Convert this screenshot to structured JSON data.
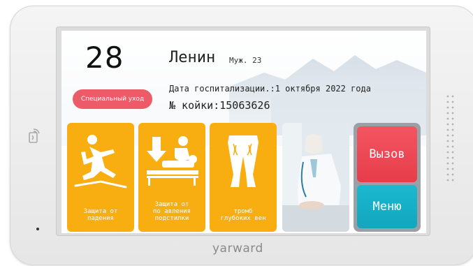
{
  "device": {
    "brand": "yarward",
    "colors": {
      "shell": "#ececec",
      "tile": "#f8ad10",
      "call": "#e9434f",
      "menu": "#16b0c8",
      "special": "#ec5b67"
    }
  },
  "screen": {
    "bed_number": "28",
    "special_care_label": "Специальный уход",
    "patient": {
      "name": "Ленин",
      "meta": "Муж. 23"
    },
    "admission_text": "Дата госпитализации.:1 октября 2022 года",
    "bed_id_text": "№ койки:15063626",
    "tiles": [
      {
        "label": "Защита от\nпадения",
        "icon": "fall-icon"
      },
      {
        "label": "Защита от\nпо авления\nподстилки",
        "icon": "bed-patient-icon"
      },
      {
        "label": "тромб\nглубоких вен",
        "icon": "legs-thrombosis-icon"
      }
    ],
    "photo_icon": "doctor-photo",
    "actions": {
      "call_label": "Вызов",
      "menu_label": "Меню"
    }
  }
}
